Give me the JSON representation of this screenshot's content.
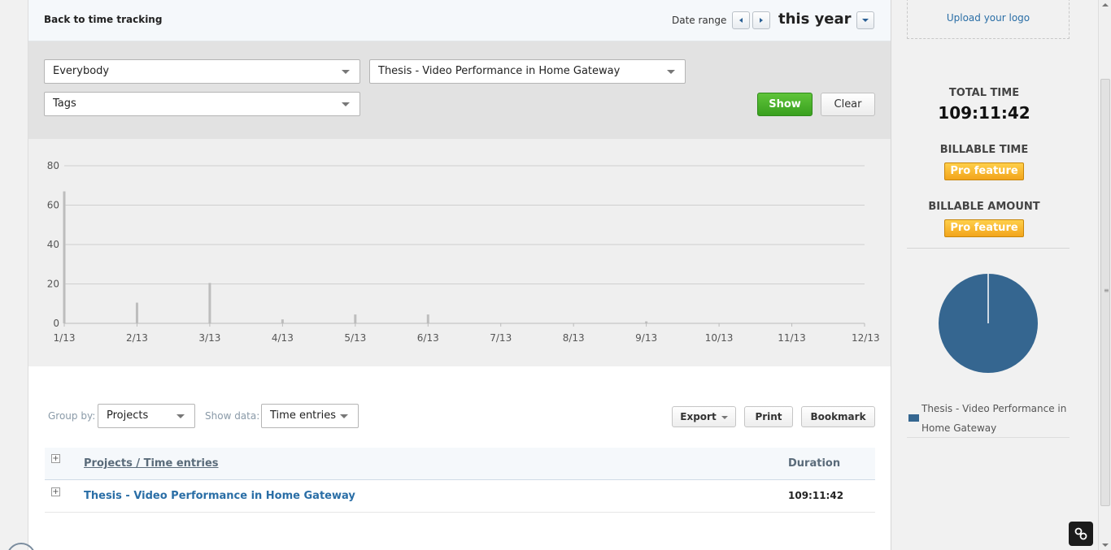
{
  "topbar": {
    "back_link": "Back to time tracking",
    "date_range_label": "Date range",
    "range_value": "this year"
  },
  "filters": {
    "user_select": "Everybody",
    "project_select": "Thesis - Video Performance in Home Gateway",
    "tags_select": "Tags",
    "show_label": "Show",
    "clear_label": "Clear"
  },
  "chart_data": {
    "type": "bar",
    "categories": [
      "1/13",
      "2/13",
      "3/13",
      "4/13",
      "5/13",
      "6/13",
      "7/13",
      "8/13",
      "9/13",
      "10/13",
      "11/13",
      "12/13"
    ],
    "values": [
      67,
      10.5,
      20.5,
      2,
      4.5,
      4.5,
      0,
      0,
      1,
      0,
      0,
      0
    ],
    "y_ticks": [
      "0",
      "20",
      "40",
      "60",
      "80"
    ],
    "ylim": [
      0,
      80
    ],
    "grid": true,
    "bar_color": "#bdbdbd"
  },
  "controls": {
    "group_by_label": "Group by:",
    "group_by_value": "Projects",
    "show_data_label": "Show data:",
    "show_data_value": "Time entries",
    "export_label": "Export",
    "print_label": "Print",
    "bookmark_label": "Bookmark"
  },
  "table": {
    "header_project": "Projects / Time entries",
    "header_duration": "Duration",
    "expander": "+",
    "rows": [
      {
        "project": "Thesis - Video Performance in Home Gateway",
        "duration": "109:11:42"
      }
    ]
  },
  "sidebar": {
    "upload_logo": "Upload your logo",
    "total_time_label": "TOTAL TIME",
    "total_time_value": "109:11:42",
    "billable_time_label": "BILLABLE TIME",
    "billable_amount_label": "BILLABLE AMOUNT",
    "pro_feature": "Pro feature",
    "pie": [
      {
        "label": "Thesis - Video Performance in Home Gateway",
        "value": 100,
        "color": "#356690"
      }
    ],
    "legend_text": "Thesis - Video Performance in Home Gateway"
  },
  "icons": {
    "prev": "chevron-left-icon",
    "next": "chevron-right-icon",
    "dropdown": "chevron-down-icon",
    "widget": "link-icon"
  }
}
